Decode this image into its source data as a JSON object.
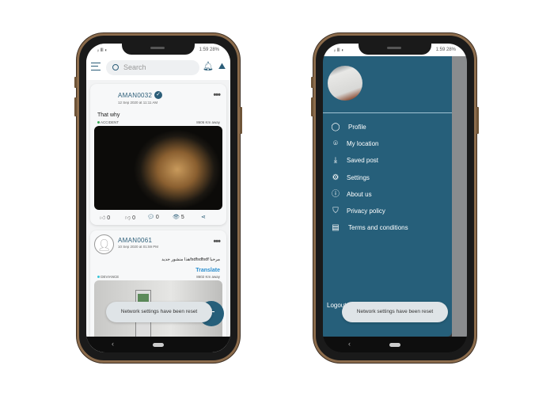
{
  "status_bar": {
    "left": "ᵢₗ Ⅲ ◐",
    "right": "1:59 28%"
  },
  "feed": {
    "search_placeholder": "Search",
    "posts": [
      {
        "username": "AMAN0032",
        "verified": true,
        "date": "12 Sep 2020 at 11:11 AM",
        "text": "That why",
        "category": "ACCIDENT",
        "category_color": "#3aa757",
        "distance": "8606 Km away",
        "likes": "0",
        "dislikes": "0",
        "comments": "0",
        "views": "5"
      },
      {
        "username": "AMAN0061",
        "date": "10 Sep 2020 at 01:59 PM",
        "text": "مرحبا fsdfsdfsdfهذا منشور جديد",
        "translate": "Translate",
        "category": "DEVIANCE",
        "category_color": "#3bc4d6",
        "distance": "8602 Km away"
      }
    ],
    "fab": "+"
  },
  "drawer": {
    "items": [
      {
        "label": "Profile",
        "icon": "user-icon"
      },
      {
        "label": "My location",
        "icon": "location-pin-icon"
      },
      {
        "label": "Saved post",
        "icon": "download-icon"
      },
      {
        "label": "Settings",
        "icon": "gear-icon"
      },
      {
        "label": "About us",
        "icon": "info-icon"
      },
      {
        "label": "Privacy policy",
        "icon": "shield-check-icon"
      },
      {
        "label": "Terms and conditions",
        "icon": "clipboard-icon"
      }
    ],
    "logout": "Logout"
  },
  "toast": "Network settings have been reset",
  "colors": {
    "primary": "#265f7a",
    "accent": "#2b8fd0"
  }
}
